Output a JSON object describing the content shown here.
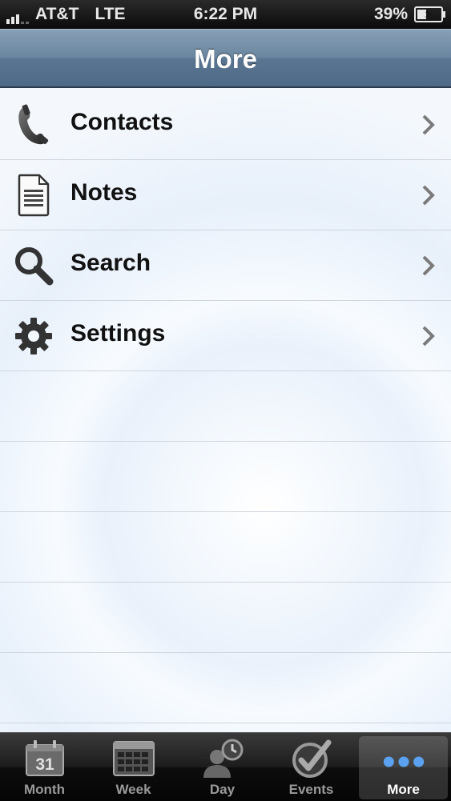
{
  "status_bar": {
    "carrier": "AT&T",
    "network": "LTE",
    "time": "6:22 PM",
    "battery_percent": "39%",
    "battery_level": 0.39
  },
  "nav_bar": {
    "title": "More"
  },
  "menu": {
    "items": [
      {
        "label": "Contacts",
        "icon": "phone-icon"
      },
      {
        "label": "Notes",
        "icon": "document-icon"
      },
      {
        "label": "Search",
        "icon": "magnifier-icon"
      },
      {
        "label": "Settings",
        "icon": "gear-icon"
      }
    ]
  },
  "tab_bar": {
    "tabs": [
      {
        "label": "Month",
        "icon": "calendar-month-icon",
        "icon_text": "31"
      },
      {
        "label": "Week",
        "icon": "calendar-week-icon"
      },
      {
        "label": "Day",
        "icon": "person-clock-icon"
      },
      {
        "label": "Events",
        "icon": "checkmark-icon"
      },
      {
        "label": "More",
        "icon": "more-dots-icon",
        "selected": true
      }
    ]
  },
  "colors": {
    "nav_bar": "#5a7592",
    "tab_selected_dots": "#4a8fe0"
  }
}
